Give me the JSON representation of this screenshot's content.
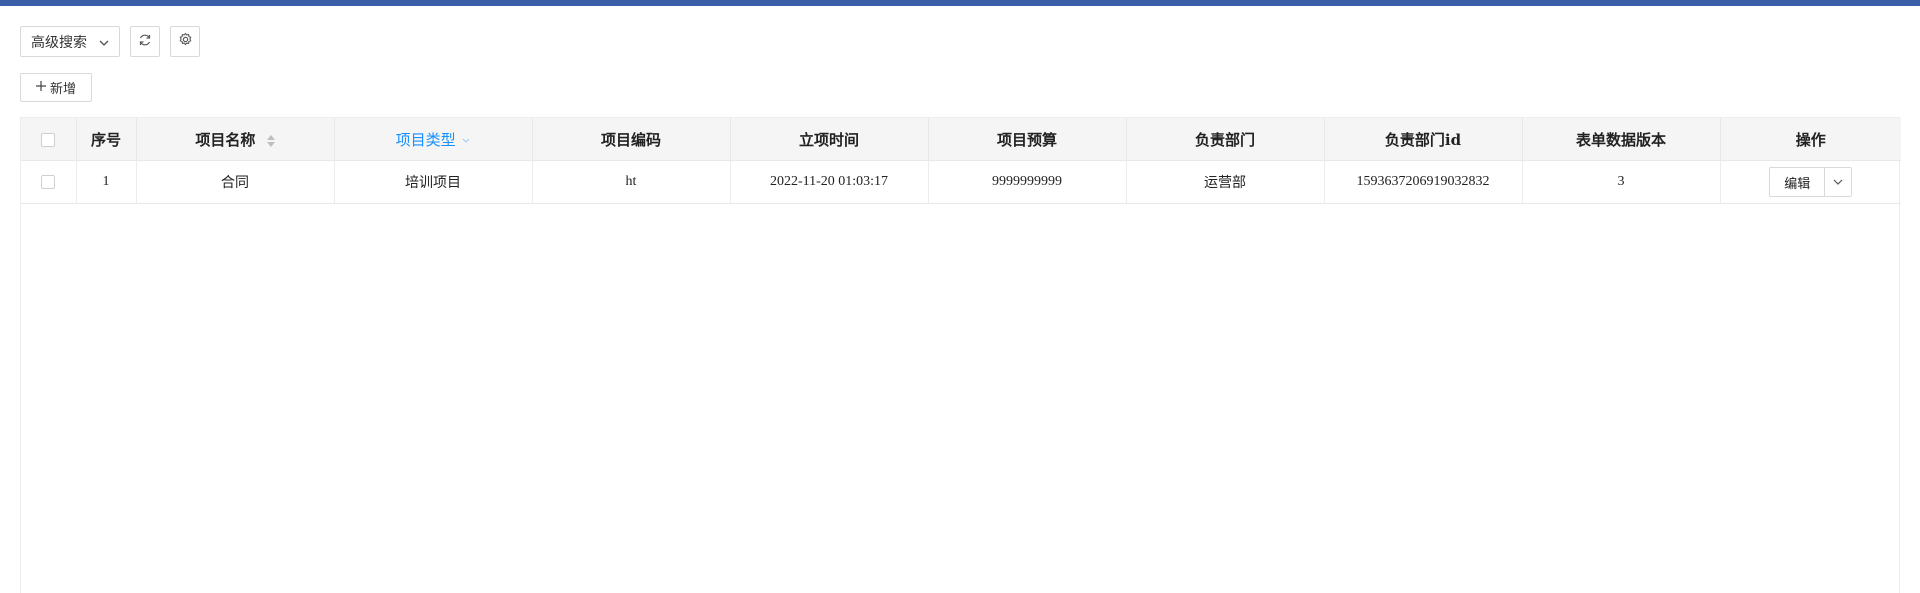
{
  "toolbar": {
    "advanced_search_label": "高级搜索",
    "add_label": "新增",
    "icons": [
      "chevron-down-icon",
      "refresh-icon",
      "gear-icon",
      "plus-icon"
    ]
  },
  "table": {
    "columns": [
      "",
      "序号",
      "项目名称",
      "项目类型",
      "项目编码",
      "立项时间",
      "项目预算",
      "负责部门",
      "负责部门id",
      "表单数据版本",
      "操作"
    ],
    "rows": [
      {
        "index": "1",
        "name": "合同",
        "type": "培训项目",
        "code": "ht",
        "created": "2022-11-20 01:03:17",
        "budget": "9999999999",
        "dept": "运营部",
        "dept_id": "1593637206919032832",
        "version": "3",
        "action_label": "编辑"
      }
    ]
  },
  "colors": {
    "accent": "#1890ff",
    "top_strip": "#3a5ea8",
    "header_bg": "#f5f5f5"
  }
}
